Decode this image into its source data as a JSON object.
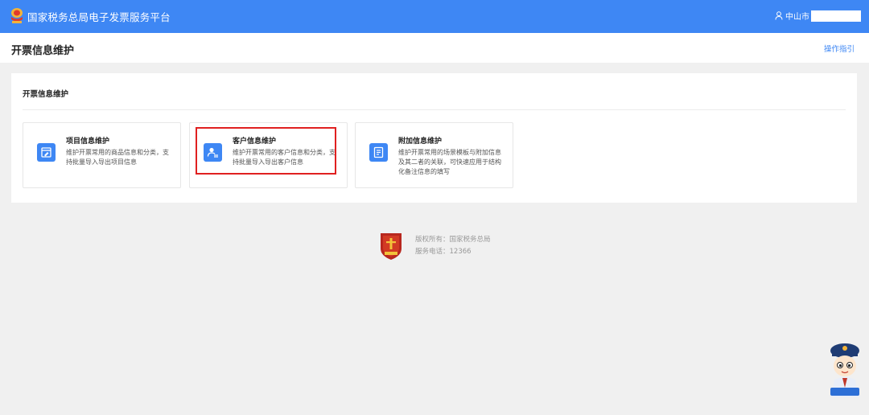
{
  "header": {
    "title": "国家税务总局电子发票服务平台",
    "user_name": "中山市",
    "colors": {
      "primary": "#3e87f4"
    }
  },
  "page": {
    "title": "开票信息维护",
    "guide_link": "操作指引"
  },
  "panel": {
    "title": "开票信息维护",
    "cards": [
      {
        "title": "项目信息维护",
        "desc": "维护开票常用的商品信息和分类，支持批量导入导出项目信息",
        "icon": "edit-form-icon"
      },
      {
        "title": "客户信息维护",
        "desc": "维护开票常用的客户信息和分类，支持批量导入导出客户信息",
        "icon": "customer-card-icon",
        "highlighted": true
      },
      {
        "title": "附加信息维护",
        "desc": "维护开票常用的场景模板与附加信息及其二者的关联，可快速应用于结构化备注信息的填写",
        "icon": "document-list-icon"
      }
    ]
  },
  "footer": {
    "copyright": "版权所有：国家税务总局",
    "phone": "服务电话：12366"
  }
}
